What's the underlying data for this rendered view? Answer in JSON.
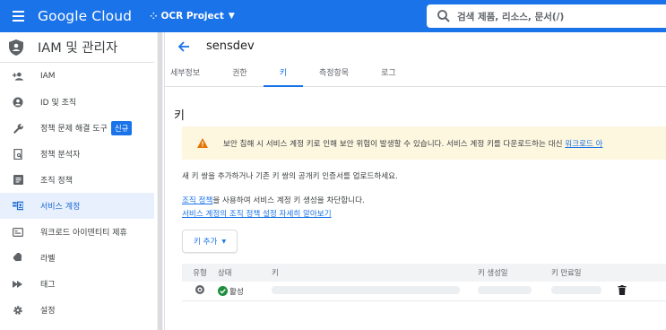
{
  "topbar": {
    "brand": "Google Cloud",
    "project": "OCR Project",
    "search_placeholder": "검색  제품, 리소스, 문서(/)"
  },
  "sidebar": {
    "title": "IAM 및 관리자",
    "items": [
      {
        "label": "IAM",
        "icon": "person-add-icon"
      },
      {
        "label": "ID 및 조직",
        "icon": "account-circle-icon"
      },
      {
        "label": "정책 문제 해결 도구",
        "icon": "wrench-icon",
        "badge": "신규"
      },
      {
        "label": "정책 분석자",
        "icon": "document-search-icon"
      },
      {
        "label": "조직 정책",
        "icon": "list-doc-icon"
      },
      {
        "label": "서비스 계정",
        "icon": "service-account-icon",
        "active": true
      },
      {
        "label": "워크로드 아이덴티티 제휴",
        "icon": "id-card-icon"
      },
      {
        "label": "라벨",
        "icon": "label-icon"
      },
      {
        "label": "태그",
        "icon": "tag-icon"
      },
      {
        "label": "설정",
        "icon": "gear-icon"
      }
    ]
  },
  "main": {
    "page_title": "sensdev",
    "tabs": [
      "세부정보",
      "권한",
      "키",
      "측정항목",
      "로그"
    ],
    "active_tab": "키",
    "section_title": "키",
    "warning": {
      "text": "보안 침해 시 서비스 계정 키로 인해 보안 위험이 발생할 수 있습니다. 서비스 계정 키를 다운로드하는 대신 ",
      "link": "워크로드 아"
    },
    "desc1": "새 키 쌍을 추가하거나 기존 키 쌍의 공개키 인증서를 업로드하세요.",
    "desc2_link": "조직 정책",
    "desc2_rest": "을 사용하여 서비스 계정 키 생성을 차단합니다.",
    "desc3_link": "서비스 계정의 조직 정책 설정 자세히 알아보기",
    "add_key_button": "키 추가",
    "table": {
      "headers": {
        "type": "유형",
        "status": "상태",
        "key": "키",
        "created": "키 생성일",
        "expires": "키 만료일"
      },
      "rows": [
        {
          "status": "활성"
        }
      ]
    }
  },
  "colors": {
    "accent": "#1a73e8",
    "warning_bg": "#fef7e0",
    "warning_icon": "#e37400",
    "success": "#1e8e3e"
  }
}
